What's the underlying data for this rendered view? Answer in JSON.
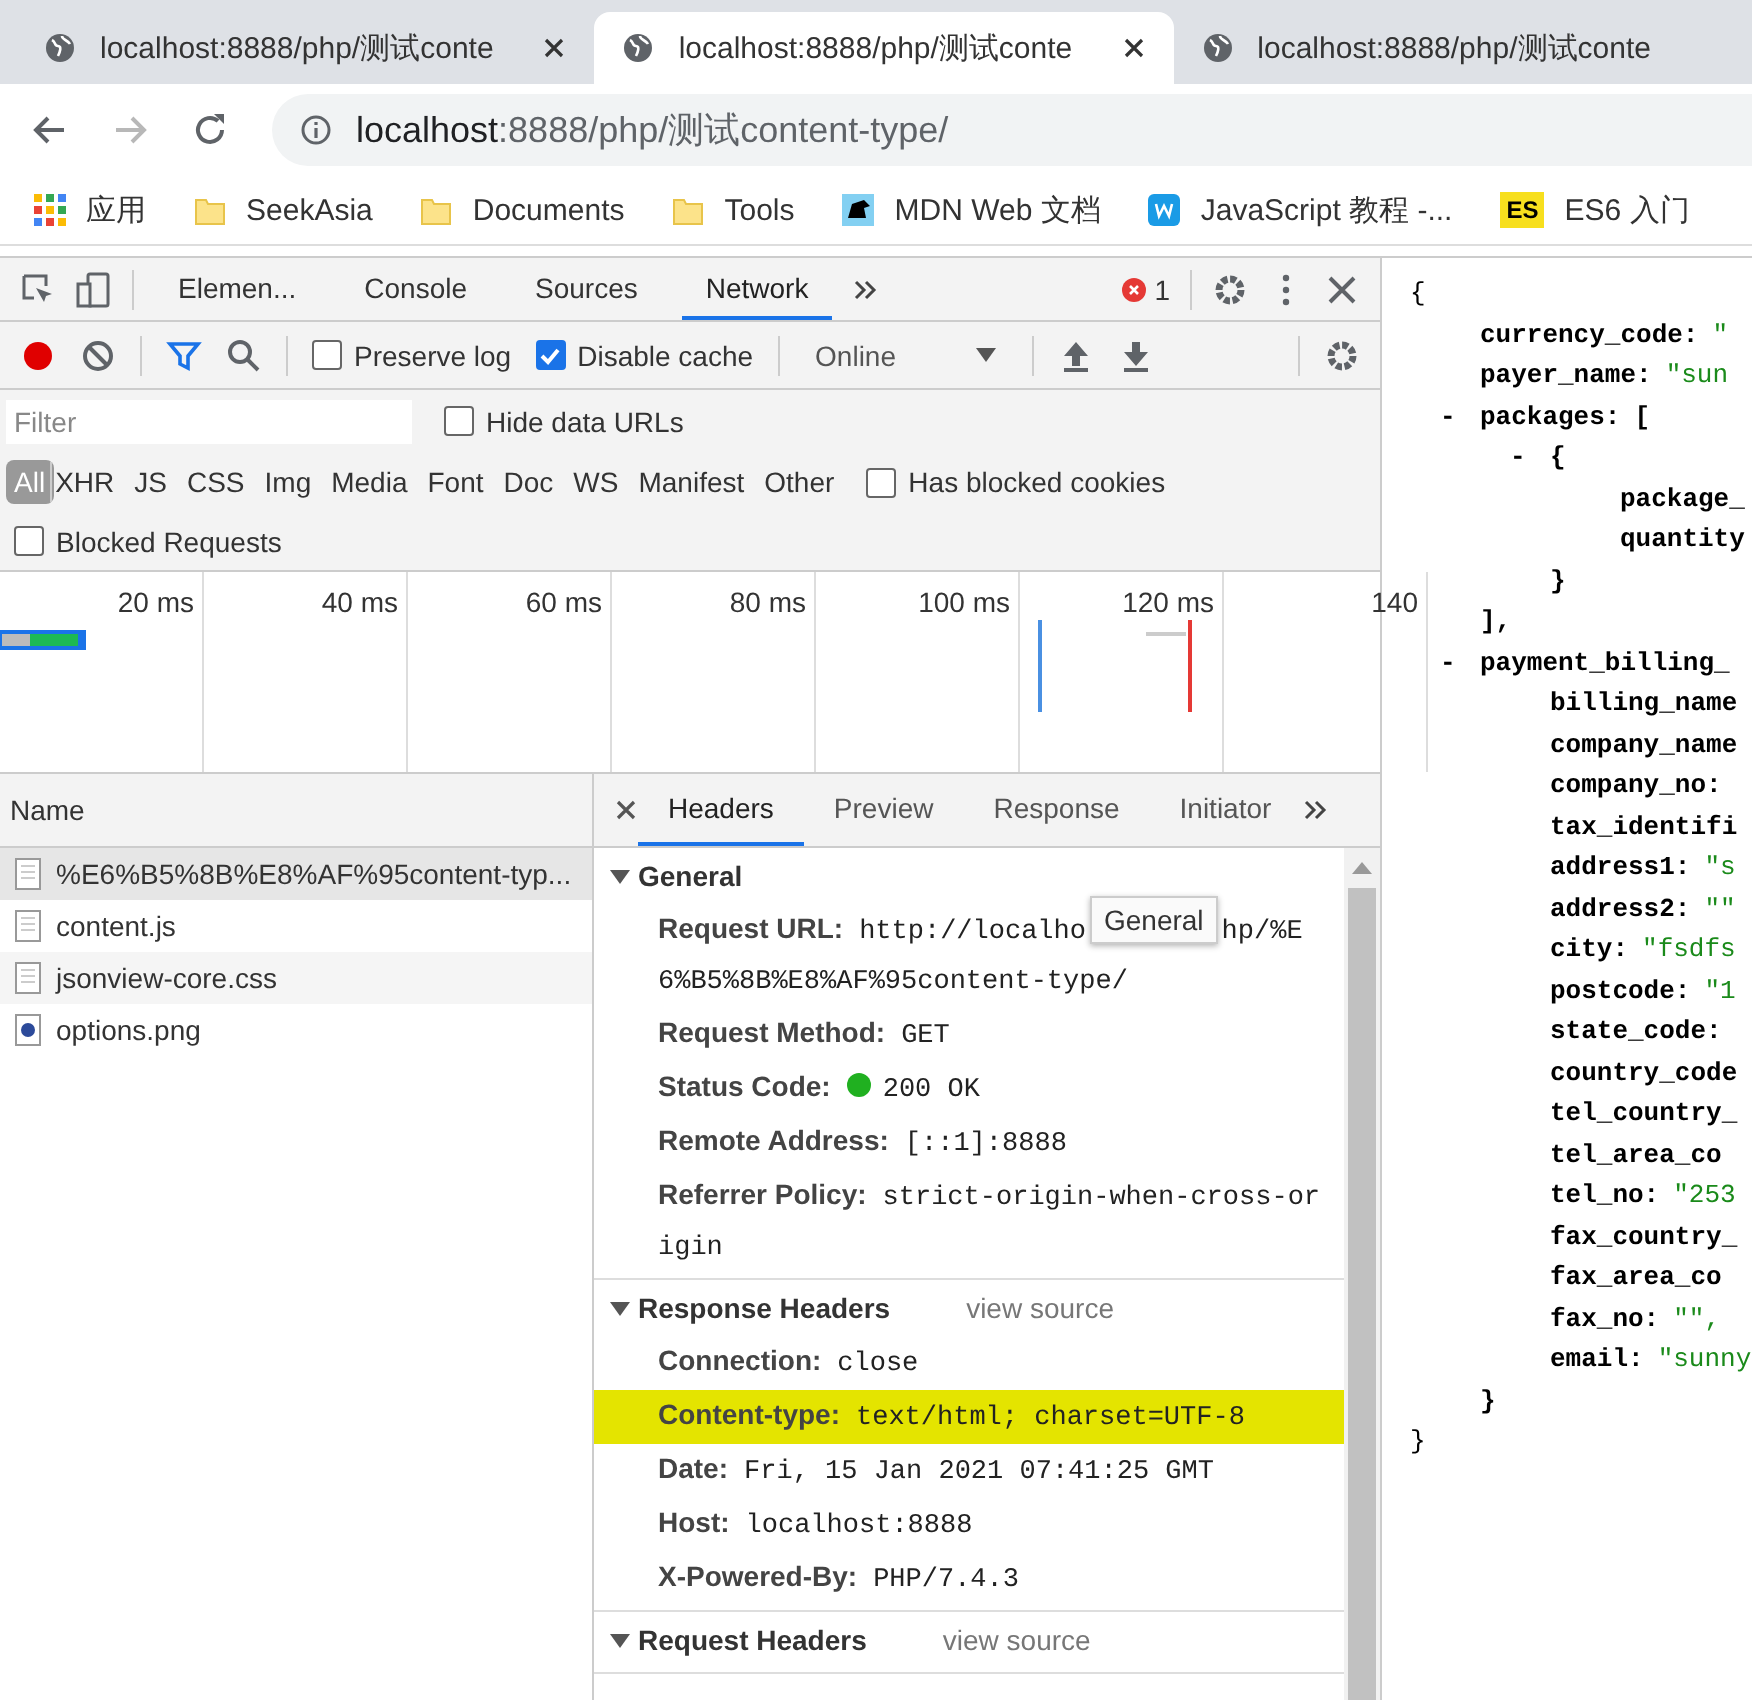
{
  "browser_tabs": [
    {
      "title": "localhost:8888/php/测试conte",
      "selected": false,
      "closable": true
    },
    {
      "title": "localhost:8888/php/测试conte",
      "selected": true,
      "closable": true
    },
    {
      "title": "localhost:8888/php/测试conte",
      "selected": false,
      "closable": false
    }
  ],
  "address": {
    "host": "localhost",
    "rest": ":8888/php/测试content-type/"
  },
  "bookmarks": [
    {
      "label": "应用",
      "kind": "apps"
    },
    {
      "label": "SeekAsia",
      "kind": "folder"
    },
    {
      "label": "Documents",
      "kind": "folder"
    },
    {
      "label": "Tools",
      "kind": "folder"
    },
    {
      "label": "MDN Web 文档",
      "kind": "mdn"
    },
    {
      "label": "JavaScript 教程 -...",
      "kind": "w"
    },
    {
      "label": "ES6 入门",
      "kind": "es",
      "badge": "ES"
    }
  ],
  "devtools": {
    "tabs": [
      {
        "label": "Elemen...",
        "selected": false
      },
      {
        "label": "Console",
        "selected": false
      },
      {
        "label": "Sources",
        "selected": false
      },
      {
        "label": "Network",
        "selected": true
      }
    ],
    "error_count": "1"
  },
  "network_toolbar": {
    "recording": true,
    "checkboxes": [
      {
        "label": "Preserve log",
        "checked": false
      },
      {
        "label": "Disable cache",
        "checked": true
      }
    ],
    "throttle": "Online"
  },
  "filter": {
    "placeholder": "Filter",
    "hide_data_urls": {
      "label": "Hide data URLs",
      "checked": false
    }
  },
  "types": [
    {
      "label": "All",
      "selected": true
    },
    {
      "label": "XHR",
      "selected": false
    },
    {
      "label": "JS",
      "selected": false
    },
    {
      "label": "CSS",
      "selected": false
    },
    {
      "label": "Img",
      "selected": false
    },
    {
      "label": "Media",
      "selected": false
    },
    {
      "label": "Font",
      "selected": false
    },
    {
      "label": "Doc",
      "selected": false
    },
    {
      "label": "WS",
      "selected": false
    },
    {
      "label": "Manifest",
      "selected": false
    },
    {
      "label": "Other",
      "selected": false
    }
  ],
  "has_blocked_cookies": {
    "label": "Has blocked cookies",
    "checked": false
  },
  "blocked_requests": {
    "label": "Blocked Requests",
    "checked": false
  },
  "timeline": {
    "ticks": [
      "20 ms",
      "40 ms",
      "60 ms",
      "80 ms",
      "100 ms",
      "120 ms",
      "140"
    ]
  },
  "requests": {
    "column": "Name",
    "rows": [
      {
        "name": "%E6%B5%8B%E8%AF%95content-typ...",
        "kind": "doc",
        "selected": true
      },
      {
        "name": "content.js",
        "kind": "doc",
        "selected": false
      },
      {
        "name": "jsonview-core.css",
        "kind": "doc",
        "selected": false
      },
      {
        "name": "options.png",
        "kind": "image",
        "selected": false
      }
    ]
  },
  "details": {
    "tabs": [
      {
        "label": "Headers",
        "selected": true
      },
      {
        "label": "Preview",
        "selected": false
      },
      {
        "label": "Response",
        "selected": false
      },
      {
        "label": "Initiator",
        "selected": false
      }
    ],
    "sections": [
      {
        "title": "General",
        "expanded": true,
        "rows": [
          {
            "key": "Request URL:",
            "value": "http://localho",
            "tooltip": "General",
            "value_after": "hp/%E",
            "value_cont": "6%B5%8B%E8%AF%95content-type/",
            "kind": "url",
            "highlighted": false
          },
          {
            "key": "Request Method:",
            "value": "GET",
            "kind": "plain",
            "highlighted": false
          },
          {
            "key": "Status Code:",
            "value": "200 OK",
            "kind": "status",
            "highlighted": false
          },
          {
            "key": "Remote Address:",
            "value": "[::1]:8888",
            "kind": "plain",
            "highlighted": false
          },
          {
            "key": "Referrer Policy:",
            "value": "strict-origin-when-cross-or",
            "value_cont": "igin",
            "kind": "plain",
            "highlighted": false
          }
        ]
      },
      {
        "title": "Response Headers",
        "expanded": true,
        "view_source": "view source",
        "rows": [
          {
            "key": "Connection:",
            "value": "close",
            "kind": "plain",
            "highlighted": false
          },
          {
            "key": "Content-type:",
            "value": "text/html; charset=UTF-8",
            "kind": "plain",
            "highlighted": true
          },
          {
            "key": "Date:",
            "value": "Fri, 15 Jan 2021 07:41:25 GMT",
            "kind": "plain",
            "highlighted": false
          },
          {
            "key": "Host:",
            "value": "localhost:8888",
            "kind": "plain",
            "highlighted": false
          },
          {
            "key": "X-Powered-By:",
            "value": "PHP/7.4.3",
            "kind": "plain",
            "highlighted": false
          }
        ]
      },
      {
        "title": "Request Headers",
        "expanded": true,
        "view_source": "view source"
      }
    ]
  },
  "json_view": {
    "open": "{",
    "close": "}",
    "items": [
      {
        "key": "currency_code:",
        "value": "\""
      },
      {
        "key": "payer_name:",
        "value": "\"sun"
      },
      {
        "toggle": "-",
        "key": "packages:",
        "open": "[",
        "close": "],",
        "children": [
          {
            "toggle": "-",
            "open": "{",
            "close": "}",
            "children": [
              {
                "key": "package_"
              },
              {
                "key": "quantity"
              }
            ]
          }
        ]
      },
      {
        "toggle": "-",
        "key": "payment_billing_",
        "close": "}",
        "children": [
          {
            "key": "billing_name"
          },
          {
            "key": "company_name"
          },
          {
            "key": "company_no:"
          },
          {
            "key": "tax_identifi"
          },
          {
            "key": "address1:",
            "value": "\"s"
          },
          {
            "key": "address2:",
            "value": "\"\""
          },
          {
            "key": "city:",
            "value": "\"fsdfs"
          },
          {
            "key": "postcode:",
            "value": "\"1"
          },
          {
            "key": "state_code:"
          },
          {
            "key": "country_code"
          },
          {
            "key": "tel_country_"
          },
          {
            "key": "tel_area_co"
          },
          {
            "key": "tel_no:",
            "value": "\"253"
          },
          {
            "key": "fax_country_"
          },
          {
            "key": "fax_area_co"
          },
          {
            "key": "fax_no:",
            "value": "\"\","
          },
          {
            "key": "email:",
            "value": "\"sunny"
          }
        ]
      }
    ]
  }
}
